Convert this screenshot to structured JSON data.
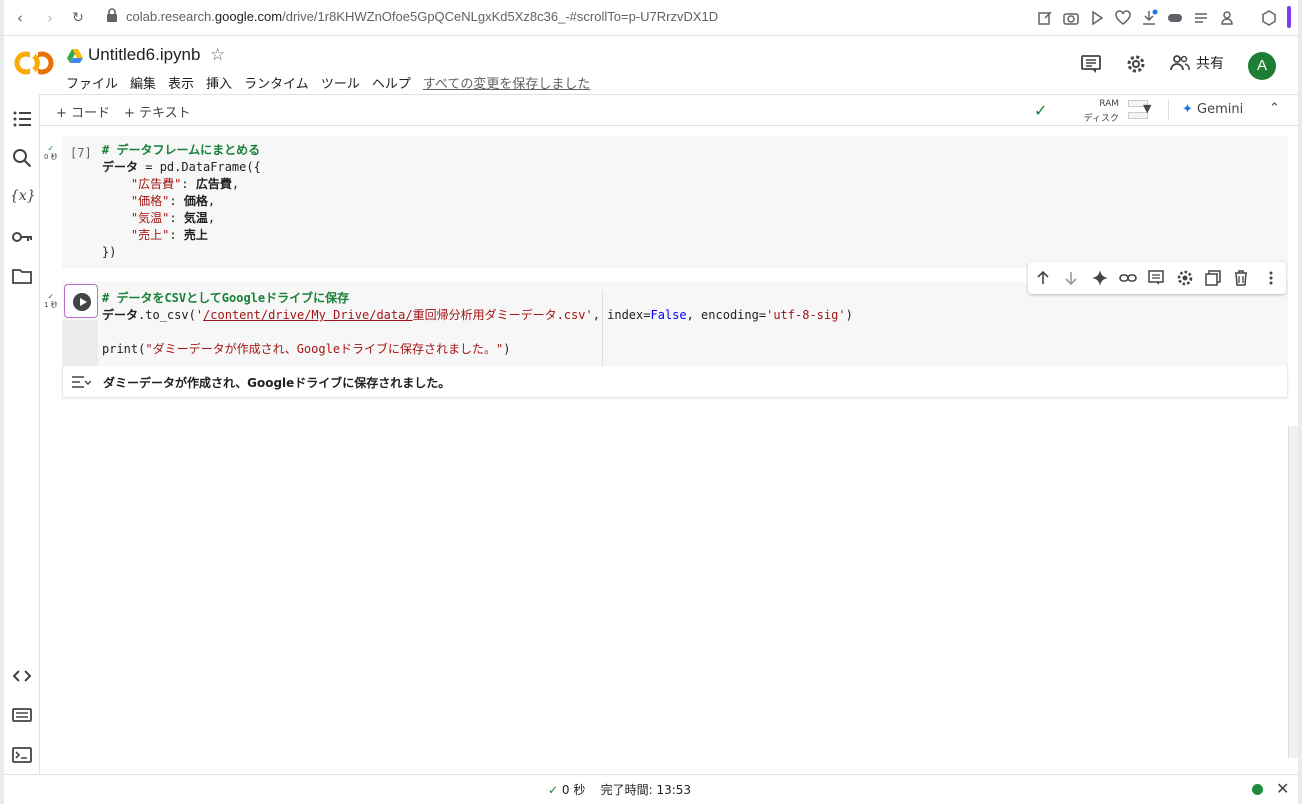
{
  "browser": {
    "url_prefix": "colab.research.",
    "url_domain": "google.com",
    "url_path": "/drive/1r8KHWZnOfoe5GpQCeNLgxKd5Xz8c36_-#scrollTo=p-U7RrzvDX1D"
  },
  "header": {
    "logo_text": "CO",
    "notebook_title": "Untitled6.ipynb",
    "menu": [
      "ファイル",
      "編集",
      "表示",
      "挿入",
      "ランタイム",
      "ツール",
      "ヘルプ"
    ],
    "saved_status": "すべての変更を保存しました",
    "share_label": "共有",
    "avatar_initial": "A"
  },
  "toolbar": {
    "add_code": "+ コード",
    "add_text": "+ テキスト",
    "ram_label": "RAM",
    "disk_label": "ディスク",
    "gemini_label": "Gemini"
  },
  "cells": [
    {
      "exec_count": "[7]",
      "time": "0 秒",
      "lines": [
        [
          {
            "t": "# データフレームにまとめる",
            "c": "cm"
          }
        ],
        [
          {
            "t": "データ",
            "c": "id"
          },
          {
            "t": " = pd.DataFrame({",
            "c": ""
          }
        ],
        [
          {
            "t": "    ",
            "c": ""
          },
          {
            "t": "\"広告費\"",
            "c": "st"
          },
          {
            "t": ": ",
            "c": ""
          },
          {
            "t": "広告費",
            "c": "id"
          },
          {
            "t": ",",
            "c": ""
          }
        ],
        [
          {
            "t": "    ",
            "c": ""
          },
          {
            "t": "\"価格\"",
            "c": "st"
          },
          {
            "t": ": ",
            "c": ""
          },
          {
            "t": "価格",
            "c": "id"
          },
          {
            "t": ",",
            "c": ""
          }
        ],
        [
          {
            "t": "    ",
            "c": ""
          },
          {
            "t": "\"気温\"",
            "c": "st"
          },
          {
            "t": ": ",
            "c": ""
          },
          {
            "t": "気温",
            "c": "id"
          },
          {
            "t": ",",
            "c": ""
          }
        ],
        [
          {
            "t": "    ",
            "c": ""
          },
          {
            "t": "\"売上\"",
            "c": "st"
          },
          {
            "t": ": ",
            "c": ""
          },
          {
            "t": "売上",
            "c": "id"
          }
        ],
        [
          {
            "t": "})",
            "c": ""
          }
        ]
      ]
    },
    {
      "exec_count": "",
      "time": "1 秒",
      "lines": [
        [
          {
            "t": "# データをCSVとしてGoogleドライブに保存",
            "c": "cm"
          }
        ],
        [
          {
            "t": "データ",
            "c": "id"
          },
          {
            "t": ".to_csv(",
            "c": ""
          },
          {
            "t": "'",
            "c": "st"
          },
          {
            "t": "/content/drive/My Drive/data/",
            "c": "st ul"
          },
          {
            "t": "重回帰分析用ダミーデータ.csv'",
            "c": "st"
          },
          {
            "t": ", index=",
            "c": ""
          },
          {
            "t": "False",
            "c": "kw"
          },
          {
            "t": ", encoding=",
            "c": ""
          },
          {
            "t": "'utf-8-sig'",
            "c": "st"
          },
          {
            "t": ")",
            "c": ""
          }
        ],
        [
          {
            "t": "",
            "c": ""
          }
        ],
        [
          {
            "t": "print(",
            "c": ""
          },
          {
            "t": "\"ダミーデータが作成され、Googleドライブに保存されました。\"",
            "c": "st"
          },
          {
            "t": ")",
            "c": ""
          }
        ]
      ],
      "output": "ダミーデータが作成され、Googleドライブに保存されました。"
    }
  ],
  "status": {
    "elapsed": "0 秒",
    "completed": "完了時間: 13:53"
  },
  "colors": {
    "accent_green": "#188038",
    "logo_orange": "#f9ab00",
    "logo_dark": "#e8710a"
  }
}
